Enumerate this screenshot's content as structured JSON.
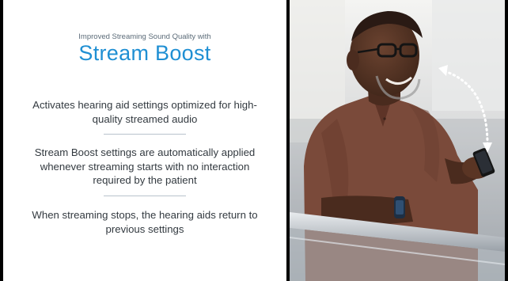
{
  "slide": {
    "subtitle": "Improved Streaming Sound Quality with",
    "title": "Stream Boost",
    "paragraphs": [
      "Activates hearing aid settings optimized for high-quality streamed audio",
      "Stream Boost settings are automatically applied whenever streaming starts with no interaction required by the patient",
      "When streaming stops, the hearing aids return to previous settings"
    ],
    "colors": {
      "title": "#1f8fd3",
      "body_text": "#333a40",
      "subtitle": "#5b6b78",
      "divider": "#b9c3cc"
    }
  },
  "photo": {
    "subject": "man-smiling-at-phone",
    "icons": [
      "dotted-arrow-icon"
    ]
  }
}
